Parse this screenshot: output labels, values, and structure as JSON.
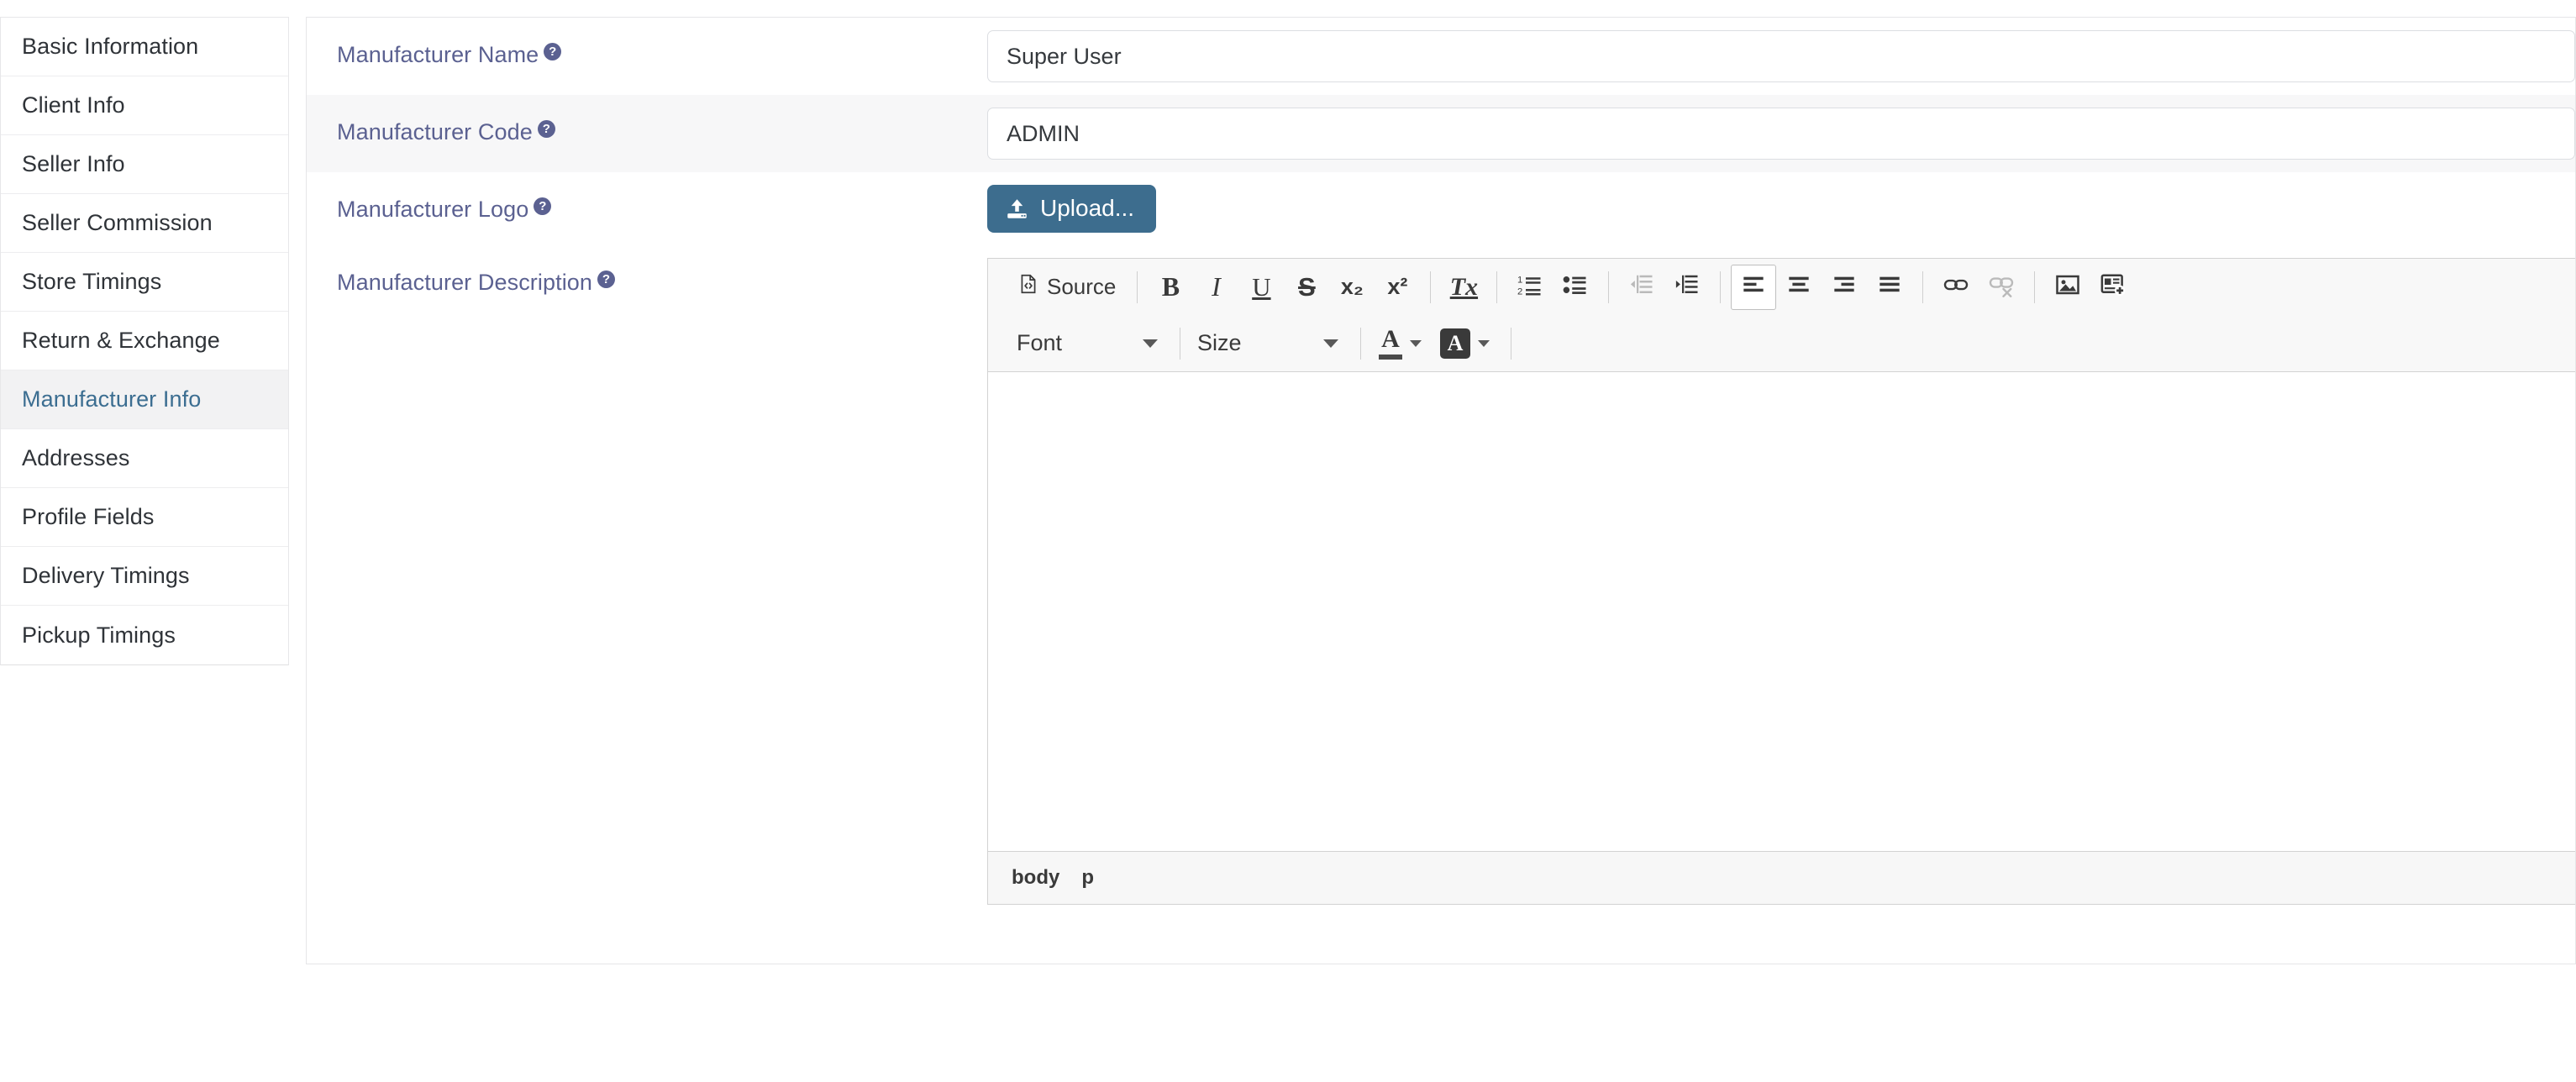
{
  "sidebar": {
    "items": [
      {
        "label": "Basic Information",
        "active": false
      },
      {
        "label": "Client Info",
        "active": false
      },
      {
        "label": "Seller Info",
        "active": false
      },
      {
        "label": "Seller Commission",
        "active": false
      },
      {
        "label": "Store Timings",
        "active": false
      },
      {
        "label": "Return & Exchange",
        "active": false
      },
      {
        "label": "Manufacturer Info",
        "active": true
      },
      {
        "label": "Addresses",
        "active": false
      },
      {
        "label": "Profile Fields",
        "active": false
      },
      {
        "label": "Delivery Timings",
        "active": false
      },
      {
        "label": "Pickup Timings",
        "active": false
      }
    ]
  },
  "form": {
    "help_glyph": "?",
    "rows": {
      "manufacturer_name": {
        "label": "Manufacturer Name",
        "value": "Super User",
        "placeholder": "Manufacturer Name"
      },
      "manufacturer_code": {
        "label": "Manufacturer Code",
        "value": "ADMIN",
        "placeholder": "Manufacturer Code"
      },
      "manufacturer_logo": {
        "label": "Manufacturer Logo",
        "upload_label": "Upload..."
      },
      "manufacturer_description": {
        "label": "Manufacturer Description"
      }
    }
  },
  "editor": {
    "toolbar_row1": [
      {
        "name": "source",
        "label": "Source",
        "type": "text-button"
      },
      {
        "name": "separator"
      },
      {
        "name": "bold",
        "label": "B"
      },
      {
        "name": "italic",
        "label": "I"
      },
      {
        "name": "underline",
        "label": "U"
      },
      {
        "name": "strike",
        "label": "S"
      },
      {
        "name": "subscript",
        "label": "x₂"
      },
      {
        "name": "superscript",
        "label": "x²"
      },
      {
        "name": "separator"
      },
      {
        "name": "remove-format",
        "label": "Tx"
      },
      {
        "name": "separator"
      },
      {
        "name": "numbered-list"
      },
      {
        "name": "bulleted-list"
      },
      {
        "name": "separator"
      },
      {
        "name": "outdent",
        "disabled": true
      },
      {
        "name": "indent"
      },
      {
        "name": "separator"
      },
      {
        "name": "align-left",
        "active": true
      },
      {
        "name": "align-center"
      },
      {
        "name": "align-right"
      },
      {
        "name": "align-justify"
      },
      {
        "name": "separator"
      },
      {
        "name": "link"
      },
      {
        "name": "unlink",
        "disabled": true
      },
      {
        "name": "separator"
      },
      {
        "name": "image"
      },
      {
        "name": "template"
      }
    ],
    "font_label": "Font",
    "size_label": "Size",
    "text_color_label": "A",
    "bg_color_label": "A",
    "content": "",
    "footer_path": [
      "body",
      "p"
    ]
  },
  "colors": {
    "accent": "#3d6d8e",
    "label": "#5b6191",
    "active_nav": "#3c6e91",
    "stripe": "#f7f7f8",
    "border": "#e6e6e8",
    "toolbar_bg": "#f8f8f8"
  }
}
